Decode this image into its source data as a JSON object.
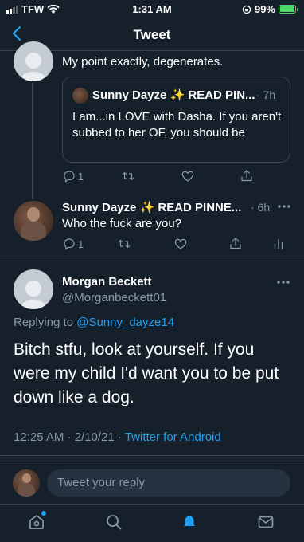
{
  "status_bar": {
    "carrier": "TFW",
    "time": "1:31 AM",
    "battery": "99%"
  },
  "header": {
    "title": "Tweet",
    "back_icon": "chevron-left-icon"
  },
  "tweet_1": {
    "text": "My point exactly, degenerates.",
    "quote": {
      "author": "Sunny Dayze ✨ READ PIN...",
      "time": "· 7h",
      "text": "I am...in LOVE with Dasha. If you aren't subbed to her OF, you should be"
    },
    "reply_count": "1"
  },
  "tweet_2": {
    "author": "Sunny Dayze ✨ READ PINNE...",
    "time": "· 6h",
    "text": "Who the fuck are you?",
    "reply_count": "1"
  },
  "main_tweet": {
    "name": "Morgan Beckett",
    "handle": "@Morganbeckett01",
    "replying_prefix": "Replying to",
    "replying_to": "@Sunny_dayze14",
    "text": "Bitch stfu, look at yourself. If you were my child I'd want you to be put down like a dog.",
    "timestamp": "12:25 AM · 2/10/21 ·",
    "source": "Twitter for Android"
  },
  "reply": {
    "placeholder": "Tweet your reply"
  },
  "tabs": [
    "home-icon",
    "search-icon",
    "notifications-icon",
    "messages-icon"
  ],
  "colors": {
    "background": "#15202b",
    "accent": "#1da1f2",
    "secondary_text": "#8899a6",
    "border": "#38444d"
  }
}
